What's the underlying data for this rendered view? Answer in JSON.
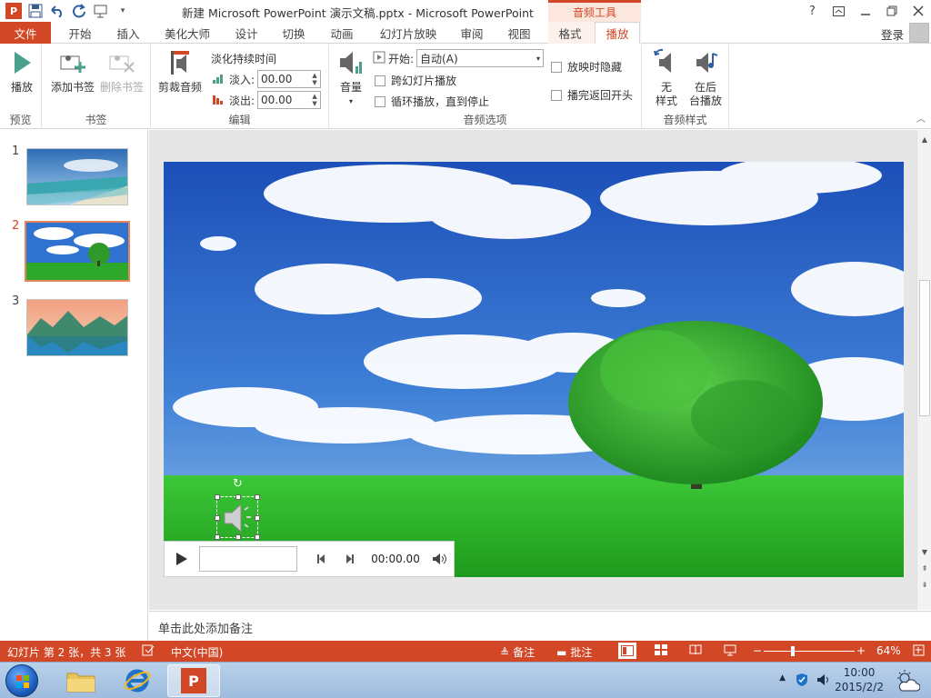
{
  "window": {
    "title": "新建 Microsoft PowerPoint 演示文稿.pptx - Microsoft PowerPoint",
    "context_tools": "音频工具",
    "help": "?",
    "login": "登录"
  },
  "tabs": [
    "文件",
    "开始",
    "插入",
    "美化大师",
    "设计",
    "切换",
    "动画",
    "幻灯片放映",
    "审阅",
    "视图",
    "格式",
    "播放"
  ],
  "active_tab": "播放",
  "ribbon": {
    "preview": {
      "play_label": "播放",
      "group": "预览"
    },
    "bookmarks": {
      "add_label": "添加书签",
      "remove_label": "删除书签",
      "group": "书签"
    },
    "edit": {
      "trim_label": "剪裁音频",
      "fade_title": "淡化持续时间",
      "fade_in_label": "淡入:",
      "fade_in_value": "00.00",
      "fade_out_label": "淡出:",
      "fade_out_value": "00.00",
      "group": "编辑"
    },
    "audio_options": {
      "volume_label": "音量",
      "start_label": "开始:",
      "start_value": "自动(A)",
      "cross_slides": "跨幻灯片播放",
      "loop": "循环播放，直到停止",
      "hide_show": "放映时隐藏",
      "rewind": "播完返回开头",
      "group": "音频选项"
    },
    "audio_styles": {
      "no_style_line1": "无",
      "no_style_line2": "样式",
      "bg_line1": "在后",
      "bg_line2": "台播放",
      "group": "音频样式"
    }
  },
  "thumbnails": [
    {
      "num": "1"
    },
    {
      "num": "2"
    },
    {
      "num": "3"
    }
  ],
  "selected_slide": 2,
  "media": {
    "time": "00:00.00"
  },
  "notes_placeholder": "单击此处添加备注",
  "status": {
    "slide_info": "幻灯片 第 2 张，共 3 张",
    "language": "中文(中国)",
    "notes": "备注",
    "comments": "批注",
    "zoom": "64%",
    "zoom_fraction": 0.64
  },
  "taskbar": {
    "time": "10:00",
    "date": "2015/2/2"
  },
  "colors": {
    "accent": "#d24726",
    "ribbon_bg": "#ffffff",
    "taskbar": "#a8c4e4"
  }
}
